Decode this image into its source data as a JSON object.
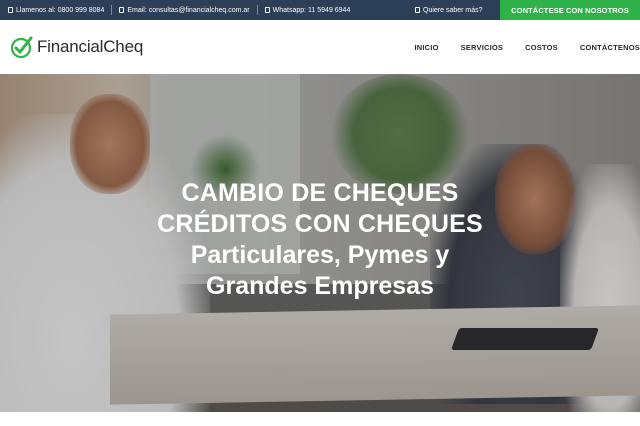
{
  "topbar": {
    "phone": "Llamenos al: 0800 999 8084",
    "email": "Email: consultas@financialcheq.com.ar",
    "whatsapp": "Whatsapp: 11 5949 6944",
    "more": "Quiere saber más?",
    "contact_button": "CONTÁCTESE CON NOSOTROS"
  },
  "header": {
    "brand": "FinancialCheq",
    "nav": [
      "INICIO",
      "SERVICIOS",
      "COSTOS",
      "CONTÁCTENOS"
    ]
  },
  "hero": {
    "line1": "CAMBIO DE CHEQUES",
    "line2": "CRÉDITOS CON CHEQUES",
    "line3": "Particulares, Pymes y",
    "line4": "Grandes Empresas"
  },
  "colors": {
    "topbar_bg": "#2d3e57",
    "accent_green": "#2fb24a",
    "text_dark": "#2b2b2b"
  },
  "icons": {
    "logo": "check-circle-icon",
    "phone": "phone-icon",
    "email": "mail-icon",
    "whatsapp": "whatsapp-icon",
    "question": "question-icon"
  }
}
